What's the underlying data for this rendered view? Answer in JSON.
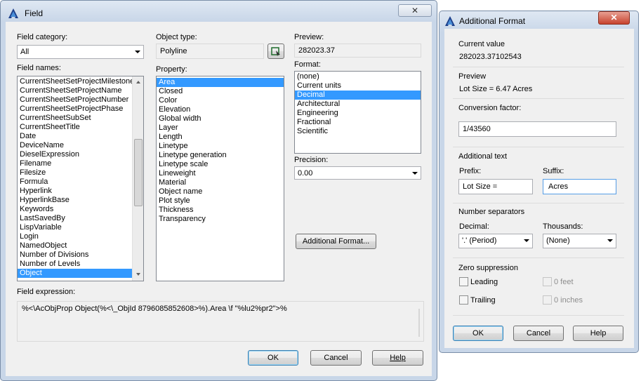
{
  "field_dialog": {
    "title": "Field",
    "close_label": "✕",
    "field_category_label": "Field category:",
    "field_category_value": "All",
    "field_names_label": "Field names:",
    "field_names": [
      "CurrentSheetSetProjectMilestone",
      "CurrentSheetSetProjectName",
      "CurrentSheetSetProjectNumber",
      "CurrentSheetSetProjectPhase",
      "CurrentSheetSubSet",
      "CurrentSheetTitle",
      "Date",
      "DeviceName",
      "DieselExpression",
      "Filename",
      "Filesize",
      "Formula",
      "Hyperlink",
      "HyperlinkBase",
      "Keywords",
      "LastSavedBy",
      "LispVariable",
      "Login",
      "NamedObject",
      "Number of Divisions",
      "Number of Levels",
      "Object"
    ],
    "field_names_selected": "Object",
    "object_type_label": "Object type:",
    "object_type_value": "Polyline",
    "select_object_icon": "select-object-icon",
    "property_label": "Property:",
    "properties": [
      "Area",
      "Closed",
      "Color",
      "Elevation",
      "Global width",
      "Layer",
      "Length",
      "Linetype",
      "Linetype generation",
      "Linetype scale",
      "Lineweight",
      "Material",
      "Object name",
      "Plot style",
      "Thickness",
      "Transparency"
    ],
    "property_selected": "Area",
    "preview_label": "Preview:",
    "preview_value": "282023.37",
    "format_label": "Format:",
    "formats": [
      "(none)",
      "Current units",
      "Decimal",
      "Architectural",
      "Engineering",
      "Fractional",
      "Scientific"
    ],
    "format_selected": "Decimal",
    "precision_label": "Precision:",
    "precision_value": "0.00",
    "additional_format_button": "Additional Format...",
    "field_expression_label": "Field expression:",
    "field_expression_value": "%<\\AcObjProp Object(%<\\_ObjId 8796085852608>%).Area \\f \"%lu2%pr2\">%",
    "ok_button": "OK",
    "cancel_button": "Cancel",
    "help_button": "Help"
  },
  "additional_format_dialog": {
    "title": "Additional Format",
    "close_label": "✕",
    "current_value_label": "Current value",
    "current_value": "282023.37102543",
    "preview_label": "Preview",
    "preview_value": "Lot Size = 6.47 Acres",
    "conversion_factor_label": "Conversion factor:",
    "conversion_factor_value": "1/43560",
    "additional_text_label": "Additional text",
    "prefix_label": "Prefix:",
    "prefix_value": "Lot Size =",
    "suffix_label": "Suffix:",
    "suffix_value": "Acres",
    "number_separators_label": "Number separators",
    "decimal_label": "Decimal:",
    "decimal_value": "'.' (Period)",
    "thousands_label": "Thousands:",
    "thousands_value": "(None)",
    "zero_suppression_label": "Zero suppression",
    "leading_label": "Leading",
    "trailing_label": "Trailing",
    "zero_feet_label": "0 feet",
    "zero_inches_label": "0 inches",
    "leading_checked": false,
    "trailing_checked": false,
    "ok_button": "OK",
    "cancel_button": "Cancel",
    "help_button": "Help"
  },
  "colors": {
    "selection": "#3399ff",
    "title_bar": "#c8d6e8",
    "dialog_bg": "#f0f0f0",
    "autocad_icon": "#1c3f8a"
  }
}
